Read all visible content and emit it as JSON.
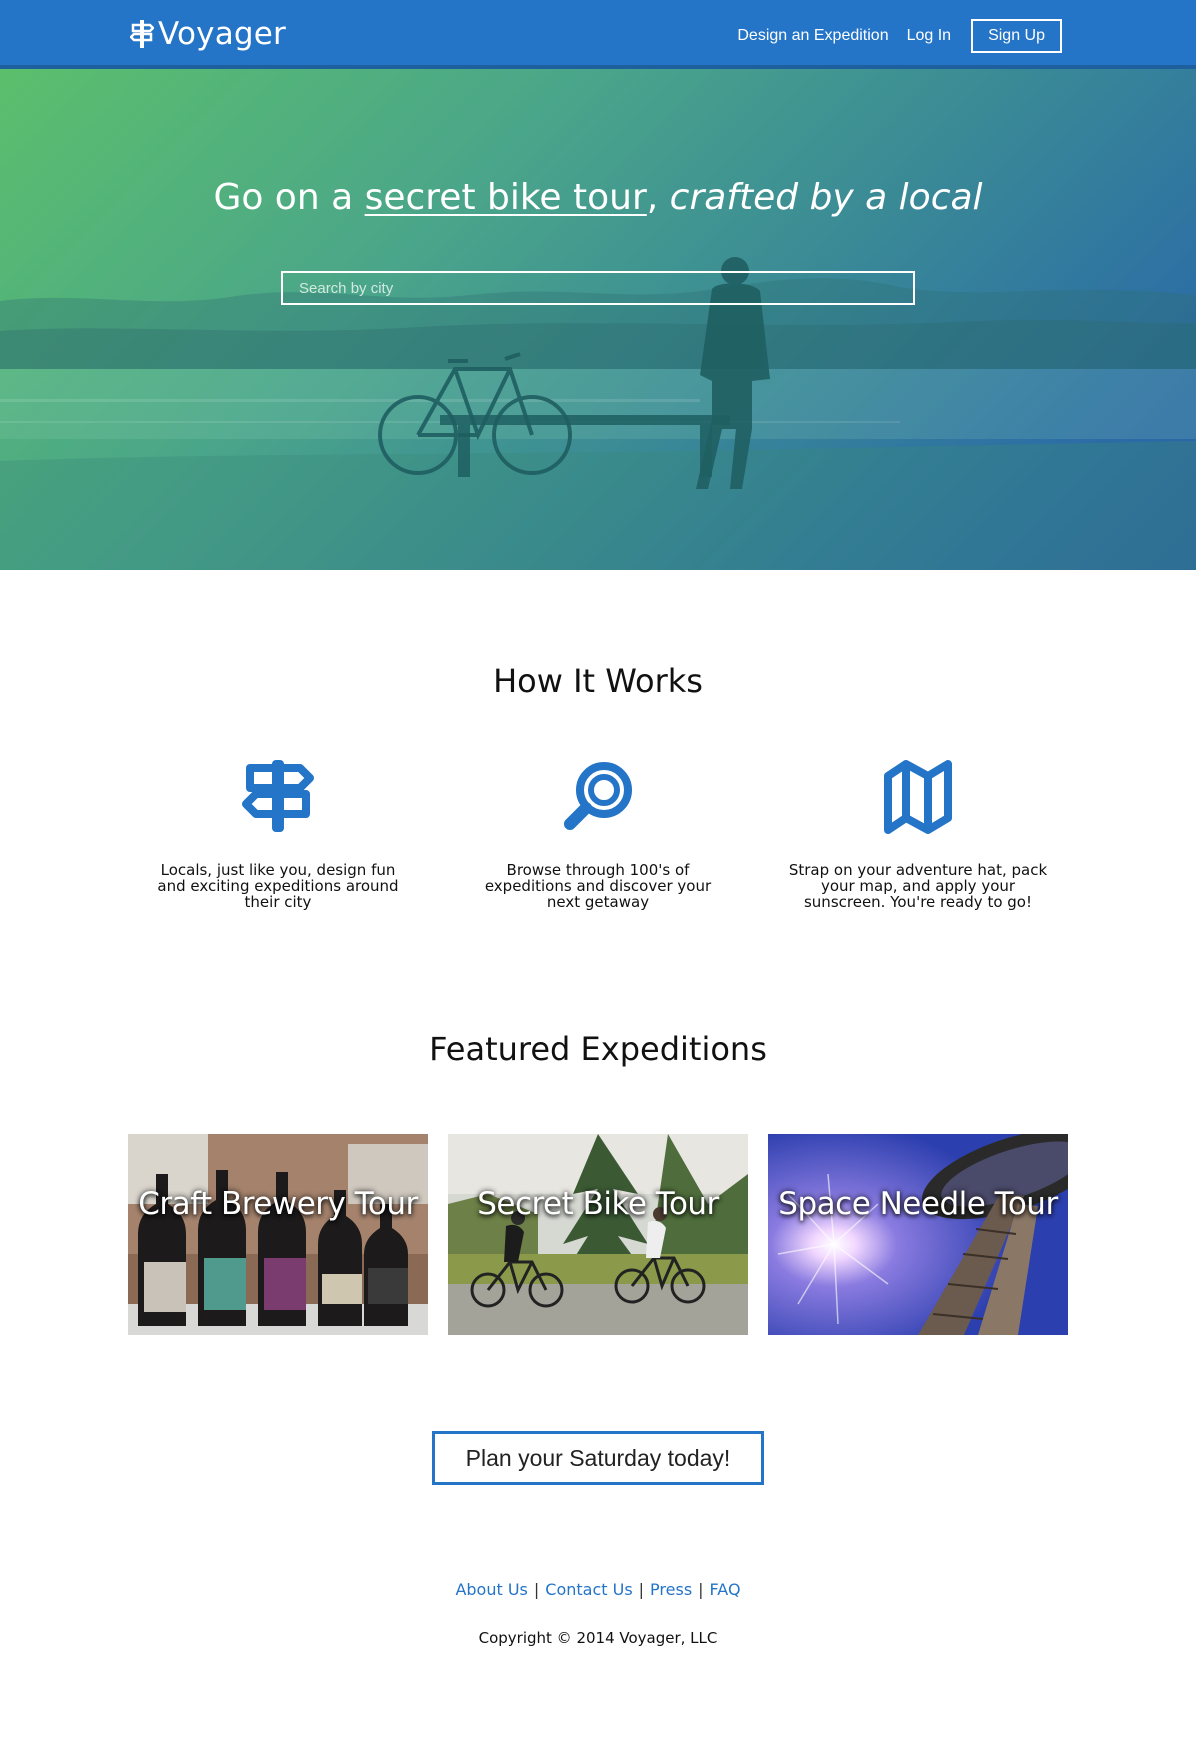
{
  "nav": {
    "brand": "Voyager",
    "links": [
      "Design an Expedition",
      "Log In"
    ],
    "signup": "Sign Up"
  },
  "hero": {
    "title_part1": "Go on a ",
    "title_link": "secret bike tour",
    "title_part2": ", ",
    "title_italic": "crafted by a local",
    "search_placeholder": "Search by city"
  },
  "how_it_works": {
    "title": "How It Works",
    "steps": [
      {
        "icon": "signpost-icon",
        "text": "Locals, just like you, design fun and exciting expeditions around their city"
      },
      {
        "icon": "magnifier-icon",
        "text": "Browse through 100's of expeditions and discover your next getaway"
      },
      {
        "icon": "map-icon",
        "text": "Strap on your adventure hat, pack your map, and apply your sunscreen. You're ready to go!"
      }
    ]
  },
  "featured": {
    "title": "Featured Expeditions",
    "cards": [
      {
        "title": "Craft Brewery Tour"
      },
      {
        "title": "Secret Bike Tour"
      },
      {
        "title": "Space Needle Tour"
      }
    ]
  },
  "cta": {
    "label": "Plan your Saturday today!"
  },
  "footer": {
    "links": [
      "About Us",
      "Contact Us",
      "Press",
      "FAQ"
    ],
    "copyright": "Copyright © 2014 Voyager, LLC"
  },
  "colors": {
    "brand": "#2474c7",
    "nav": "#2474c7",
    "hero_start": "#5bbf6c",
    "hero_end": "#2960a5"
  }
}
